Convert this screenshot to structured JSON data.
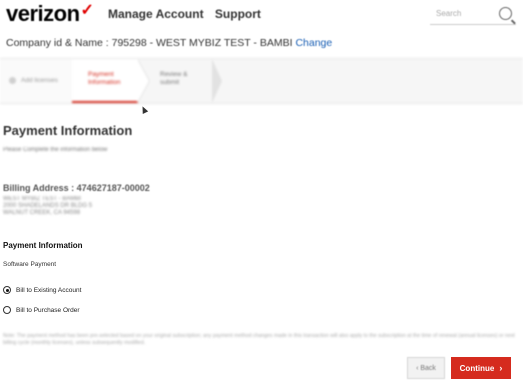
{
  "header": {
    "logo": "verizon",
    "logo_mark": "✓",
    "nav": [
      "Manage Account",
      "Support"
    ],
    "search_placeholder": "Search"
  },
  "company": {
    "label": "Company id & Name : 795298 - WEST MYBIZ TEST - BAMBI",
    "change_link": "Change"
  },
  "stepper": {
    "steps": [
      {
        "label": "Add licenses",
        "state": "done"
      },
      {
        "label": "Payment Information",
        "state": "active"
      },
      {
        "label": "Review & submit",
        "state": "pending"
      }
    ]
  },
  "payment": {
    "title": "Payment Information",
    "subtitle": "Please Complete the information below",
    "billing_title": "Billing Address : 474627187-00002",
    "address_lines": [
      "WEST MYBIZ TEST - BAMBI",
      "2000 SHADELANDS DR BLDG 5",
      "WALNUT CREEK, CA 94598"
    ],
    "section_title": "Payment Information",
    "software_payment": "Software Payment",
    "options": [
      {
        "label": "Bill to Existing Account",
        "selected": true
      },
      {
        "label": "Bill to Purchase Order",
        "selected": false
      }
    ],
    "note": "Note: The payment method has been pre-selected based on your original subscription; any payment method changes made in this transaction will also apply to the subscription at the time of renewal (annual licenses) or next billing cycle (monthly licenses), unless subsequently modified."
  },
  "buttons": {
    "back": "‹ Back",
    "continue": "Continue",
    "continue_icon": "›"
  },
  "colors": {
    "brand_red": "#d52b1e",
    "link_blue": "#1a5fb4"
  }
}
